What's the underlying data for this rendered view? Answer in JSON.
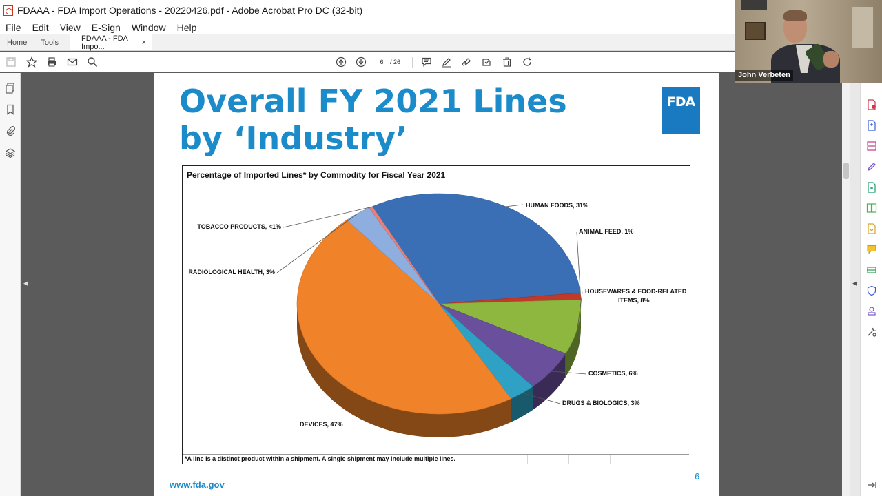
{
  "window": {
    "title": "FDAAA - FDA Import Operations - 20220426.pdf - Adobe Acrobat Pro DC (32-bit)"
  },
  "menu": [
    "File",
    "Edit",
    "View",
    "E-Sign",
    "Window",
    "Help"
  ],
  "tabs": {
    "home": "Home",
    "tools": "Tools",
    "document": "FDAAA - FDA Impo...",
    "close": "×"
  },
  "toolbar": {
    "current_page": "6",
    "total_pages": "/ 26"
  },
  "slide": {
    "title": "Overall FY 2021 Lines by ‘Industry’",
    "logo_text": "FDA",
    "url": "www.fda.gov",
    "page_number": "6"
  },
  "chart_data": {
    "type": "pie",
    "title": "Percentage of Imported Lines* by Commodity for Fiscal Year 2021",
    "footnote": "*A line is a distinct product within a shipment. A single shipment may include multiple lines.",
    "slices": [
      {
        "label": "HUMAN FOODS, 31%",
        "value": 31,
        "color": "#3a6fb5"
      },
      {
        "label": "ANIMAL FEED, 1%",
        "value": 1,
        "color": "#c0392b"
      },
      {
        "label": "HOUSEWARES & FOOD-RELATED ITEMS, 8%",
        "value": 8,
        "color": "#8db73f"
      },
      {
        "label": "COSMETICS, 6%",
        "value": 6,
        "color": "#6a4f9c"
      },
      {
        "label": "DRUGS & BIOLOGICS, 3%",
        "value": 3,
        "color": "#2ea1c4"
      },
      {
        "label": "DEVICES, 47%",
        "value": 47,
        "color": "#f0822a"
      },
      {
        "label": "RADIOLOGICAL HEALTH, 3%",
        "value": 3,
        "color": "#8faee0"
      },
      {
        "label": "TOBACCO PRODUCTS, <1%",
        "value": 0.4,
        "color": "#e8807a"
      }
    ]
  },
  "video": {
    "participant_name": "John Verbeten"
  }
}
